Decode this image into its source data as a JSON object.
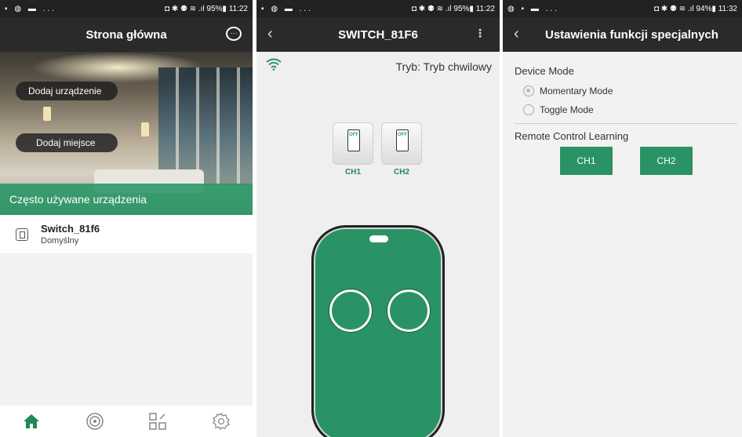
{
  "screen1": {
    "status": {
      "left": "▪ ◍ ▬ ...",
      "right": "◘ ✱ ⚉ ≋ .ıl 95%▮ 11:22"
    },
    "title": "Strona główna",
    "add_device": "Dodaj urządzenie",
    "add_place": "Dodaj miejsce",
    "frequent_label": "Często używane urządzenia",
    "device": {
      "name": "Switch_81f6",
      "room": "Domyślny"
    },
    "nav": [
      {
        "icon": "home-icon",
        "active": true
      },
      {
        "icon": "target-icon",
        "active": false
      },
      {
        "icon": "grid-edit-icon",
        "active": false
      },
      {
        "icon": "gear-icon",
        "active": false
      }
    ],
    "accent": "#2a9366"
  },
  "screen2": {
    "status": {
      "left": "▪ ◍ ▬ ...",
      "right": "◘ ✱ ⚉ ≋ .ıl 95%▮ 11:22"
    },
    "title": "SWITCH_81F6",
    "menu": "⋮",
    "mode": "Tryb: Tryb chwilowy",
    "switch_state": "OFF",
    "channels": [
      "CH1",
      "CH2"
    ]
  },
  "screen3": {
    "status": {
      "left": "◍ ▪ ▬ ...",
      "right": "◘ ✱ ⚉ ≋ .ıl 94%▮ 11:32"
    },
    "title": "Ustawienia funkcji specjalnych",
    "device_mode_label": "Device Mode",
    "modes": [
      {
        "label": "Momentary Mode",
        "selected": true
      },
      {
        "label": "Toggle Mode",
        "selected": false
      }
    ],
    "learning_label": "Remote Control Learning",
    "buttons": [
      "CH1",
      "CH2"
    ]
  }
}
